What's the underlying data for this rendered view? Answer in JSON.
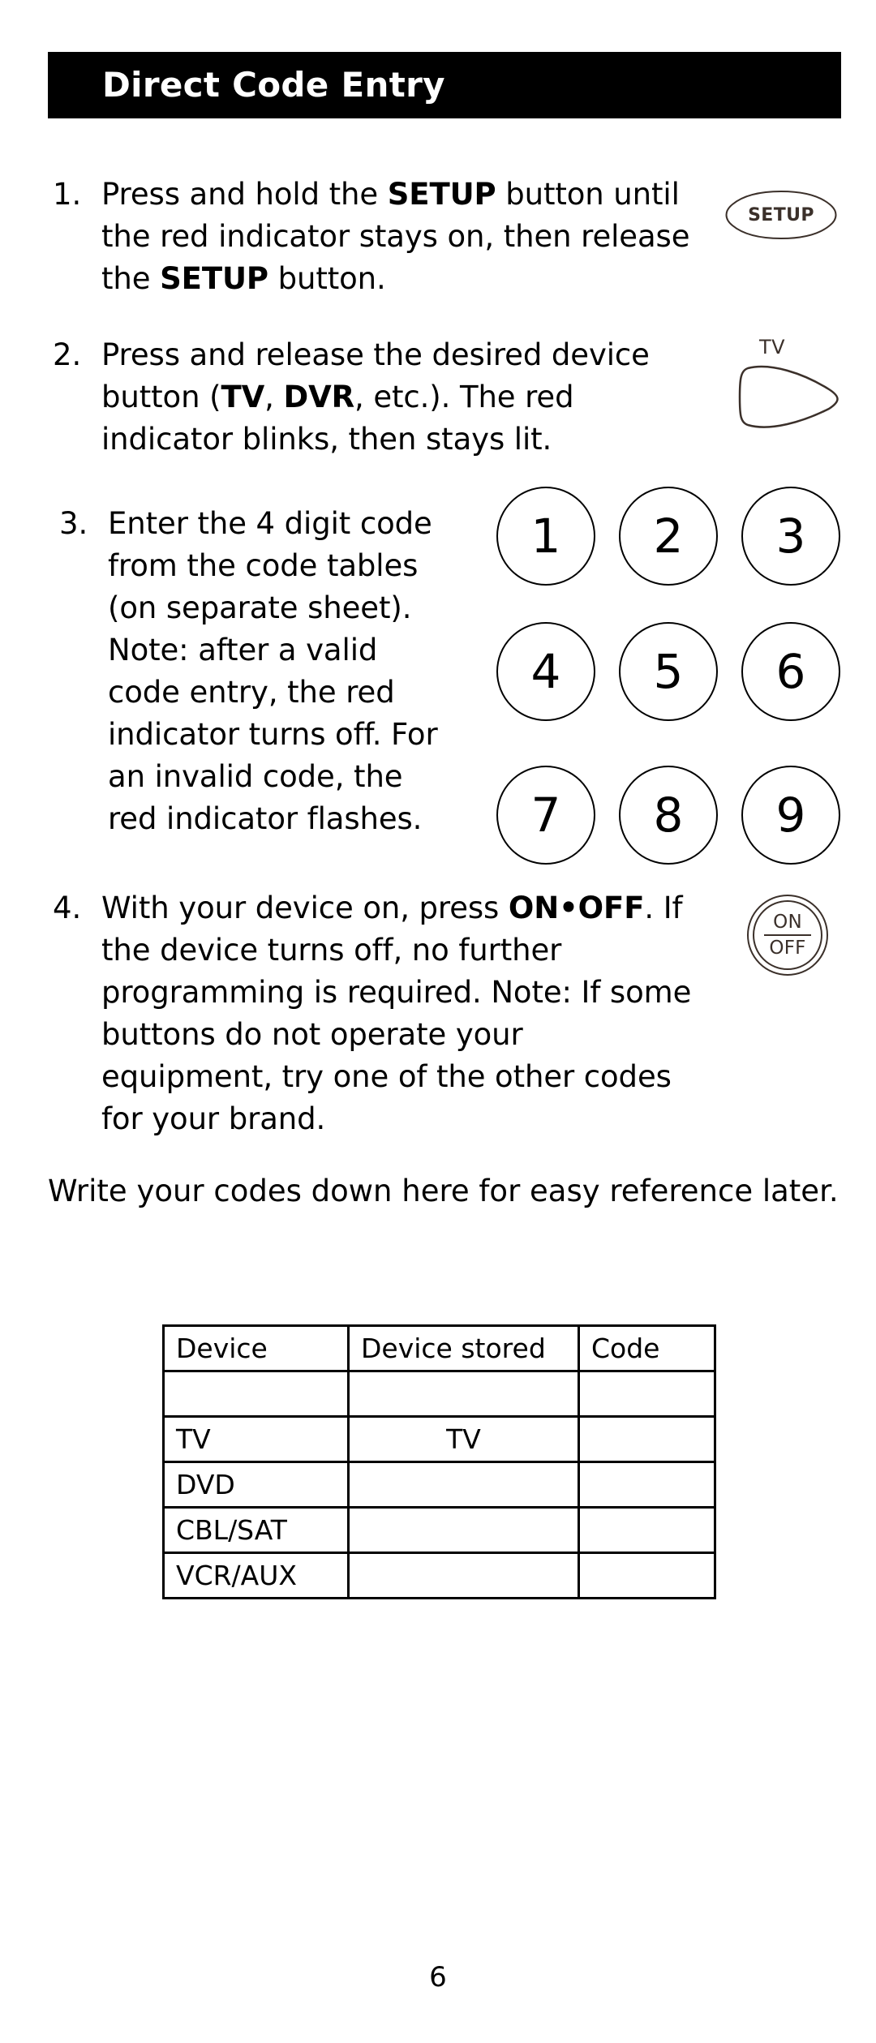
{
  "header": {
    "title": "Direct Code Entry"
  },
  "steps": [
    {
      "number": "1.",
      "text_parts": [
        {
          "text": "Press and hold the ",
          "bold": false
        },
        {
          "text": "SETUP",
          "bold": true
        },
        {
          "text": " button until the red indicator stays on, then release the ",
          "bold": false
        },
        {
          "text": "SETUP",
          "bold": true
        },
        {
          "text": " button.",
          "bold": false
        }
      ],
      "plain": "Press and hold the SETUP button until the red indicator stays on, then release the SETUP button."
    },
    {
      "number": "2.",
      "text_parts": [
        {
          "text": "Press and release the desired device button (",
          "bold": false
        },
        {
          "text": "TV",
          "bold": true
        },
        {
          "text": ", ",
          "bold": false
        },
        {
          "text": "DVR",
          "bold": true
        },
        {
          "text": ", etc.). The red indicator blinks, then stays lit.",
          "bold": false
        }
      ],
      "plain": "Press and release the desired device button (TV, DVR, etc.). The red indicator blinks, then stays lit."
    },
    {
      "number": "3.",
      "text_parts": [
        {
          "text": "Enter the 4 digit code from the code tables (on separate sheet). Note: after a valid code entry, the red indicator turns off.  For an invalid code, the red indicator flashes.",
          "bold": false
        }
      ],
      "plain": "Enter the 4 digit code from the code tables (on separate sheet). Note: after a valid code entry, the red indicator turns off.  For an invalid code, the red indicator flashes."
    },
    {
      "number": "4.",
      "text_parts": [
        {
          "text": "With your device on, press ",
          "bold": false
        },
        {
          "text": "ON•OFF",
          "bold": true
        },
        {
          "text": ". If the device turns off, no further programming is required. Note: If some buttons do not operate your equipment, try one of the other codes for your brand.",
          "bold": false
        }
      ],
      "plain": "With your device on, press ON•OFF. If the device turns off, no further programming is required. Note: If some buttons do not operate your equipment, try one of the other codes for your brand."
    }
  ],
  "remote_buttons": {
    "setup": {
      "label": "SETUP",
      "color": "#3b302a"
    },
    "device_tv": {
      "label": "TV",
      "color": "#3b302a"
    },
    "on_off": {
      "on_label": "ON",
      "off_label": "OFF",
      "color": "#3b302a"
    }
  },
  "keypad": {
    "keys": [
      "1",
      "2",
      "3",
      "4",
      "5",
      "6",
      "7",
      "8",
      "9"
    ]
  },
  "note_line": "Write your codes down here for easy reference later.",
  "table": {
    "headers": [
      "Device",
      "Device stored",
      "Code"
    ],
    "rows": [
      {
        "device": "",
        "stored": "",
        "code": ""
      },
      {
        "device": "TV",
        "stored": "TV",
        "code": ""
      },
      {
        "device": "DVD",
        "stored": "",
        "code": ""
      },
      {
        "device": "CBL/SAT",
        "stored": "",
        "code": ""
      },
      {
        "device": "VCR/AUX",
        "stored": "",
        "code": ""
      }
    ]
  },
  "footer": {
    "page_number": "6"
  }
}
